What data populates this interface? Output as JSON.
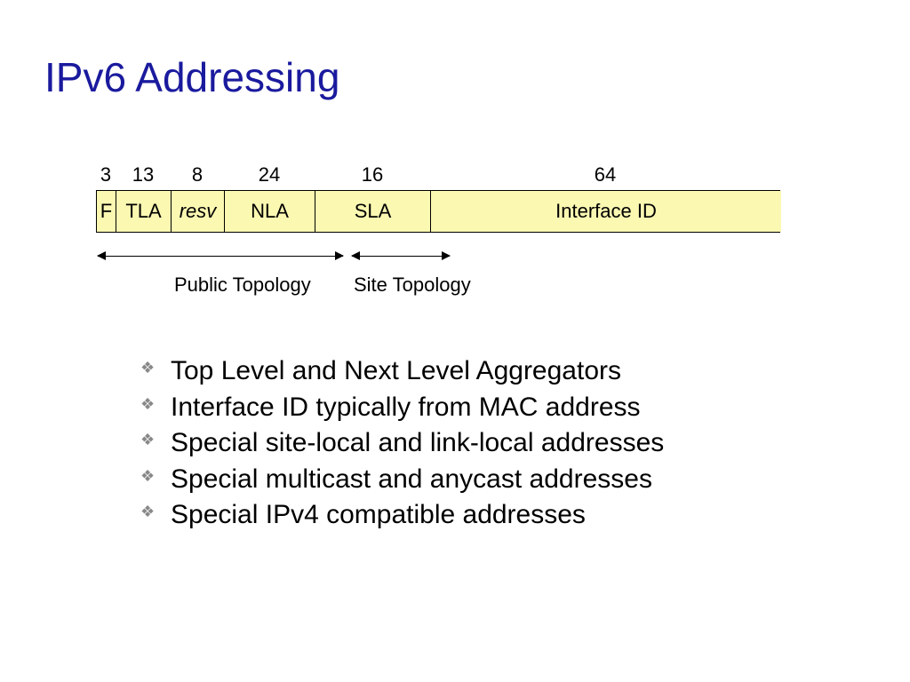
{
  "title": "IPv6 Addressing",
  "chart_data": {
    "type": "table",
    "title": "IPv6 address field layout (bits)",
    "fields": [
      {
        "bits": 3,
        "name": "F"
      },
      {
        "bits": 13,
        "name": "TLA"
      },
      {
        "bits": 8,
        "name": "resv"
      },
      {
        "bits": 24,
        "name": "NLA"
      },
      {
        "bits": 16,
        "name": "SLA"
      },
      {
        "bits": 64,
        "name": "Interface ID"
      }
    ],
    "groupings": [
      {
        "label": "Public Topology",
        "covers": [
          "F",
          "TLA",
          "resv",
          "NLA"
        ]
      },
      {
        "label": "Site Topology",
        "covers": [
          "SLA"
        ]
      }
    ]
  },
  "diagram": {
    "bits": [
      "3",
      "13",
      "8",
      "24",
      "16",
      "64"
    ],
    "fields": [
      "F",
      "TLA",
      "resv",
      "NLA",
      "SLA",
      "Interface ID"
    ],
    "public_label": "Public Topology",
    "site_label": "Site Topology"
  },
  "bullets": [
    "Top Level and Next Level Aggregators",
    "Interface ID typically from MAC address",
    "Special site-local and link-local addresses",
    "Special multicast and anycast addresses",
    "Special IPv4 compatible addresses"
  ]
}
